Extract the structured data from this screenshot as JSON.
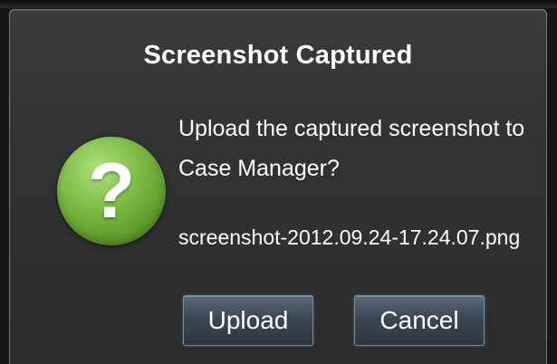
{
  "dialog": {
    "title": "Screenshot Captured",
    "message": "Upload the captured screenshot to Case Manager?",
    "filename": "screenshot-2012.09.24-17.24.07.png",
    "icon": "question-mark-icon",
    "icon_glyph": "?",
    "upload_label": "Upload",
    "cancel_label": "Cancel"
  },
  "colors": {
    "icon_green": "#7dbb45",
    "dialog_bg": "#333333",
    "button_border": "#6f8fa6"
  }
}
